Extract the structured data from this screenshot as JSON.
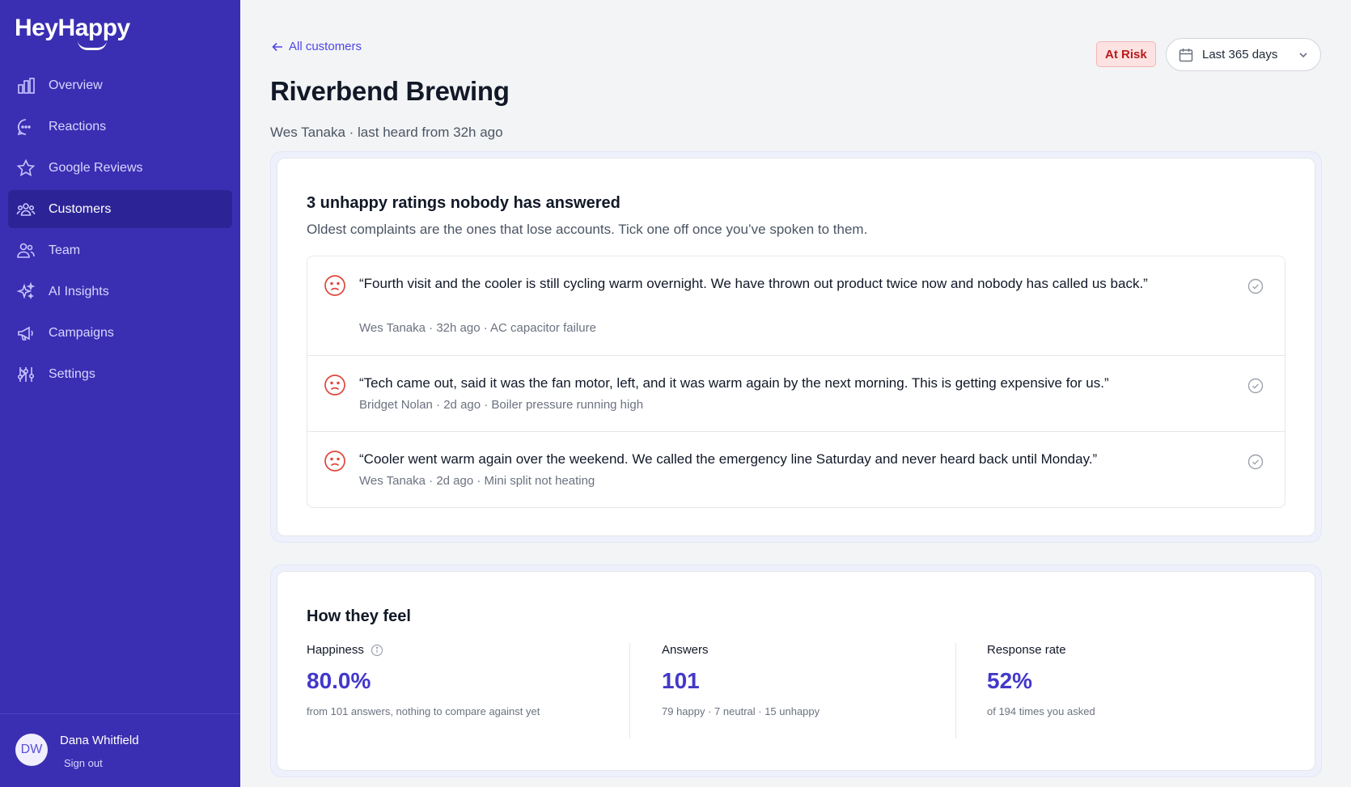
{
  "app": {
    "brand": "HeyHappy"
  },
  "sidebar": {
    "items": [
      {
        "label": "Overview",
        "icon": "bar-chart-icon"
      },
      {
        "label": "Reactions",
        "icon": "chat-bubble-icon"
      },
      {
        "label": "Google Reviews",
        "icon": "star-icon"
      },
      {
        "label": "Customers",
        "icon": "users-group-icon",
        "active": true
      },
      {
        "label": "Team",
        "icon": "team-icon"
      },
      {
        "label": "AI Insights",
        "icon": "sparkles-icon"
      },
      {
        "label": "Campaigns",
        "icon": "megaphone-icon"
      },
      {
        "label": "Settings",
        "icon": "sliders-icon"
      }
    ],
    "user": {
      "initials": "DW",
      "name": "Dana Whitfield",
      "signout": "Sign out"
    }
  },
  "header": {
    "back_label": "All customers",
    "title": "Riverbend Brewing",
    "subtitle": "Wes Tanaka · last heard from 32h ago",
    "status_badge": "At Risk",
    "date_range": "Last 365 days"
  },
  "complaints": {
    "heading": "3 unhappy ratings nobody has answered",
    "description": "Oldest complaints are the ones that lose accounts. Tick one off once you’ve spoken to them.",
    "items": [
      {
        "quote": "“Fourth visit and the cooler is still cycling warm overnight. We have thrown out product twice now and nobody has called us back.”",
        "meta": "Wes Tanaka · 32h ago · AC capacitor failure"
      },
      {
        "quote": "“Tech came out, said it was the fan motor, left, and it was warm again by the next morning. This is getting expensive for us.”",
        "meta": "Bridget Nolan · 2d ago · Boiler pressure running high"
      },
      {
        "quote": "“Cooler went warm again over the weekend. We called the emergency line Saturday and never heard back until Monday.”",
        "meta": "Wes Tanaka · 2d ago · Mini split not heating"
      }
    ]
  },
  "feelings": {
    "heading": "How they feel",
    "stats": [
      {
        "label": "Happiness",
        "value": "80.0%",
        "note": "from 101 answers, nothing to compare against yet"
      },
      {
        "label": "Answers",
        "value": "101",
        "note": "79 happy · 7 neutral · 15 unhappy"
      },
      {
        "label": "Response rate",
        "value": "52%",
        "note": "of 194 times you asked"
      }
    ]
  },
  "colors": {
    "sidebar": "#3a2fb2",
    "accent": "#4f46e5",
    "risk": "#b91c1c"
  }
}
